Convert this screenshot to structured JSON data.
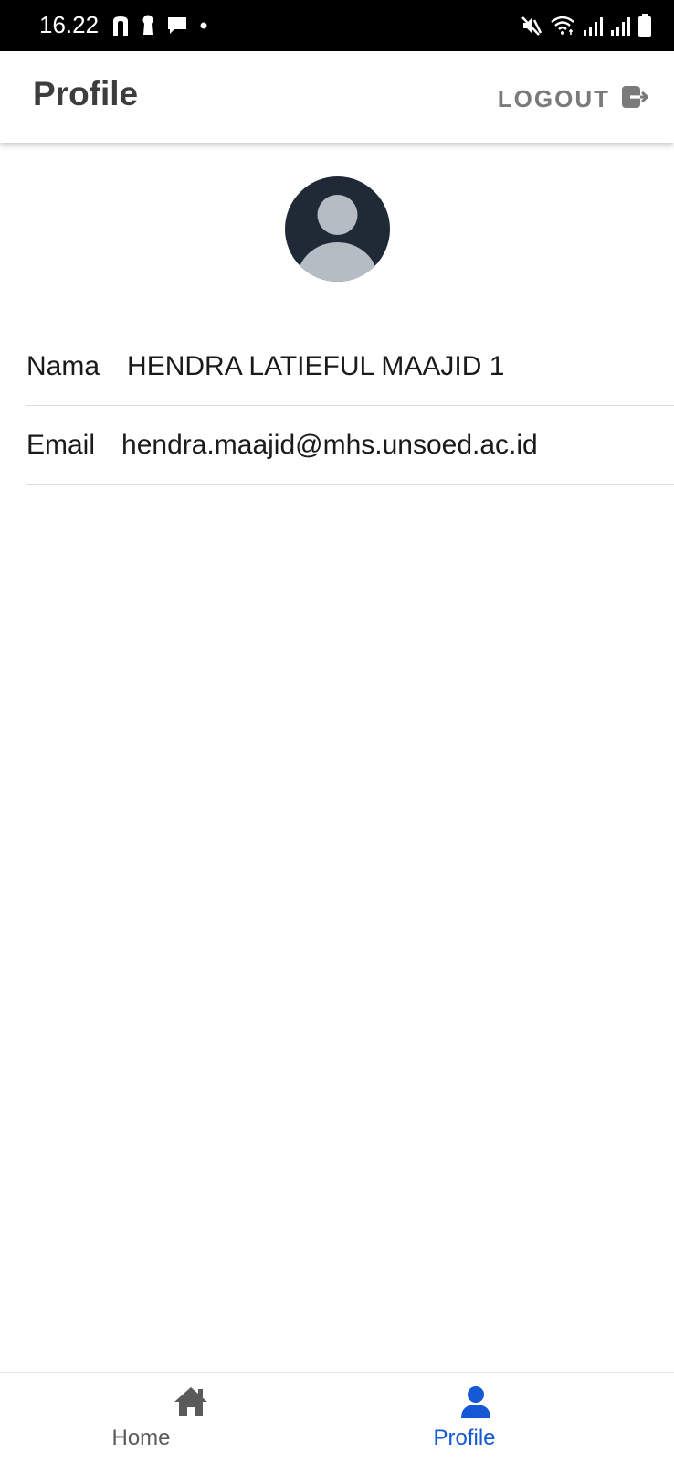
{
  "status_bar": {
    "time": "16.22",
    "left_icons": [
      "n-app-icon",
      "keyhole-icon",
      "chat-icon",
      "dot-icon"
    ],
    "right_icons": [
      "mute-icon",
      "wifi-icon",
      "signal-icon",
      "signal-icon",
      "battery-icon"
    ]
  },
  "header": {
    "title": "Profile",
    "logout_label": "LOGOUT",
    "logout_icon": "logout-icon"
  },
  "profile": {
    "avatar_icon": "person-avatar-icon",
    "fields": [
      {
        "label": "Nama",
        "value": "HENDRA LATIEFUL MAAJID 1"
      },
      {
        "label": "Email",
        "value": "hendra.maajid@mhs.unsoed.ac.id"
      }
    ]
  },
  "bottom_nav": {
    "items": [
      {
        "label": "Home",
        "icon": "home-icon",
        "active": false
      },
      {
        "label": "Profile",
        "icon": "person-icon",
        "active": true
      }
    ],
    "active_color": "#1558d6",
    "inactive_color": "#5a5a5a"
  }
}
